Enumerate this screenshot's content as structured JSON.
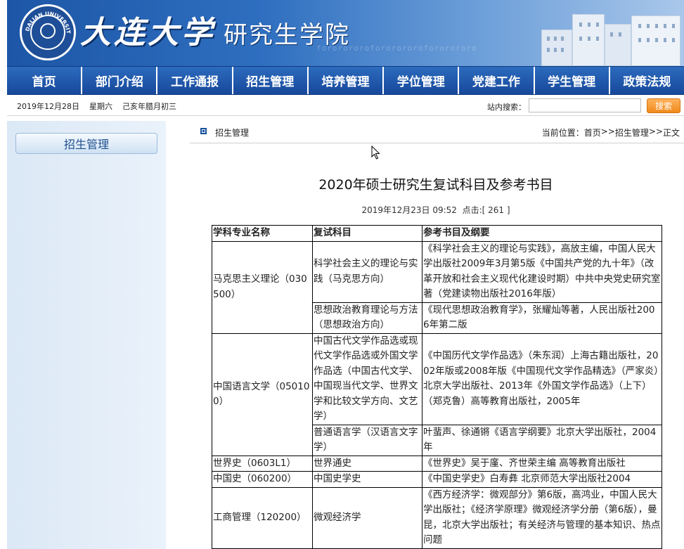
{
  "banner": {
    "university_name": "大连大学",
    "school_name": "研究生学院",
    "logo_text": "DALIAN UNIVERSITY",
    "stripe_text": "fororororofororororofororororo"
  },
  "nav": {
    "items": [
      "首页",
      "部门介绍",
      "工作通报",
      "招生管理",
      "培养管理",
      "学位管理",
      "党建工作",
      "学生管理",
      "政策法规"
    ]
  },
  "infobar": {
    "date": "2019年12月28日",
    "weekday": "星期六",
    "lunar": "己亥年腊月初三",
    "search_label": "站内搜索：",
    "search_value": "",
    "search_button": "搜索"
  },
  "sidebar": {
    "button_label": "招生管理"
  },
  "content": {
    "section_name": "招生管理",
    "breadcrumb": {
      "prefix": "当前位置：",
      "items": [
        "首页",
        ">>",
        "招生管理",
        ">>",
        "正文"
      ]
    },
    "article": {
      "title": "2020年硕士研究生复试科目及参考书目",
      "datetime": "2019年12月23日 09:52",
      "hits_label": "点击:",
      "hits_value": "[ 261 ]"
    }
  },
  "table": {
    "headers": [
      "学科专业名称",
      "复试科目",
      "参考书目及纲要"
    ],
    "rows": [
      {
        "major": "马克思主义理论（030500）",
        "subject": "科学社会主义的理论与实践（马克思方向）",
        "books": "《科学社会主义的理论与实践》，高放主编，中国人民大学出版社2009年3月第5版《中国共产党的九十年》（改革开放和社会主义现代化建设时期）中共中央党史研究室著（党建读物出版社2016年版）"
      },
      {
        "subject": "思想政治教育理论与方法（思想政治方向）",
        "books": "《现代思想政治教育学》，张耀灿等著，人民出版社2006年第二版"
      },
      {
        "major": "中国语言文学（050100）",
        "subject": "中国古代文学作品选或现代文学作品选或外国文学作品选（中国古代文学、中国现当代文学、世界文学和比较文学方向、文艺学）",
        "books": "《中国历代文学作品选》（朱东润）上海古籍出版社，2002年版或2008年版《中国现代文学作品精选》（严家炎）北京大学出版社、2013年《外国文学作品选》（上下）（郑克鲁）高等教育出版社，2005年"
      },
      {
        "subject": "普通语言学（汉语言文字学）",
        "books": "叶蜚声、徐通锵《语言学纲要》北京大学出版社，2004年"
      },
      {
        "major": "世界史（0603L1）",
        "subject": "世界通史",
        "books": "《世界史》吴于廑、齐世荣主编 高等教育出版社"
      },
      {
        "major": "中国史（060200）",
        "subject": "中国史学史",
        "books": "《中国史学史》白寿彝 北京师范大学出版社2004"
      },
      {
        "major": "工商管理（120200）",
        "subject": "微观经济学",
        "books": "《西方经济学：微观部分》第6版，高鸿业，中国人民大学出版社；《经济学原理》微观经济学分册（第6版），曼昆，北京大学出版社；有关经济与管理的基本知识、热点问题"
      }
    ]
  }
}
